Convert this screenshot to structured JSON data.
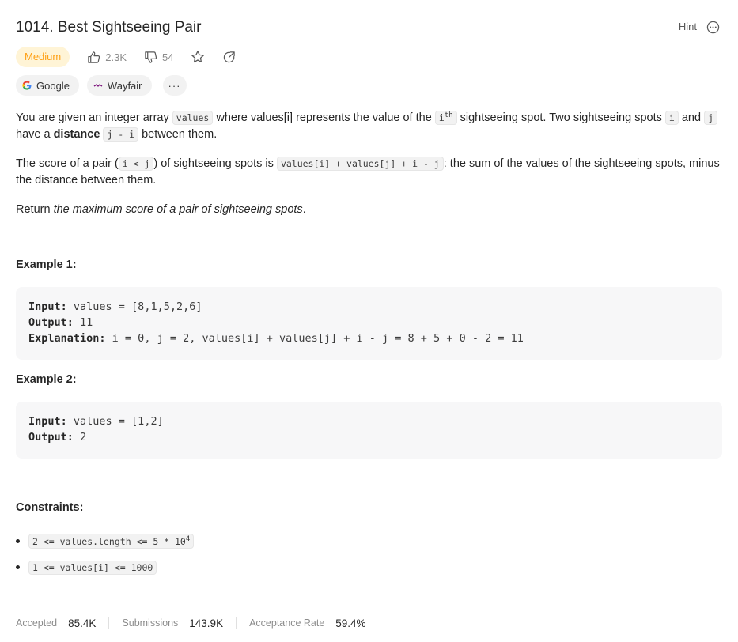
{
  "problem": {
    "title": "1014. Best Sightseeing Pair",
    "hint_label": "Hint",
    "difficulty": "Medium",
    "likes": "2.3K",
    "dislikes": "54"
  },
  "companies": [
    {
      "name": "Google",
      "icon": "google-logo-icon"
    },
    {
      "name": "Wayfair",
      "icon": "wayfair-logo-icon"
    }
  ],
  "more_label": "···",
  "description": {
    "p1_a": "You are given an integer array ",
    "p1_code1": "values",
    "p1_b": " where values[i] represents the value of the ",
    "p1_code2": "i",
    "p1_sup": "th",
    "p1_c": " sightseeing spot. Two sightseeing spots ",
    "p1_code3": "i",
    "p1_d": " and ",
    "p1_code4": "j",
    "p1_e": " have a ",
    "p1_bold": "distance",
    "p1_f": " ",
    "p1_code5": "j - i",
    "p1_g": " between them.",
    "p2_a": "The score of a pair (",
    "p2_code1": "i < j",
    "p2_b": ") of sightseeing spots is ",
    "p2_code2": "values[i] + values[j] + i - j",
    "p2_c": ": the sum of the values of the sightseeing spots, minus the distance between them.",
    "p3_a": "Return ",
    "p3_italic": "the maximum score of a pair of sightseeing spots",
    "p3_b": "."
  },
  "examples": [
    {
      "heading": "Example 1:",
      "input_label": "Input:",
      "input": " values = [8,1,5,2,6]",
      "output_label": "Output:",
      "output": " 11",
      "explanation_label": "Explanation:",
      "explanation": " i = 0, j = 2, values[i] + values[j] + i - j = 8 + 5 + 0 - 2 = 11"
    },
    {
      "heading": "Example 2:",
      "input_label": "Input:",
      "input": " values = [1,2]",
      "output_label": "Output:",
      "output": " 2"
    }
  ],
  "constraints": {
    "heading": "Constraints:",
    "c1": "2 <= values.length <= 5 * 10",
    "c1_sup": "4",
    "c2": "1 <= values[i] <= 1000"
  },
  "stats": {
    "accepted_label": "Accepted",
    "accepted": "85.4K",
    "submissions_label": "Submissions",
    "submissions": "143.9K",
    "rate_label": "Acceptance Rate",
    "rate": "59.4%"
  },
  "colors": {
    "medium_text": "#ffa116",
    "medium_bg": "#fff4d6",
    "muted": "#8c8c8c"
  }
}
